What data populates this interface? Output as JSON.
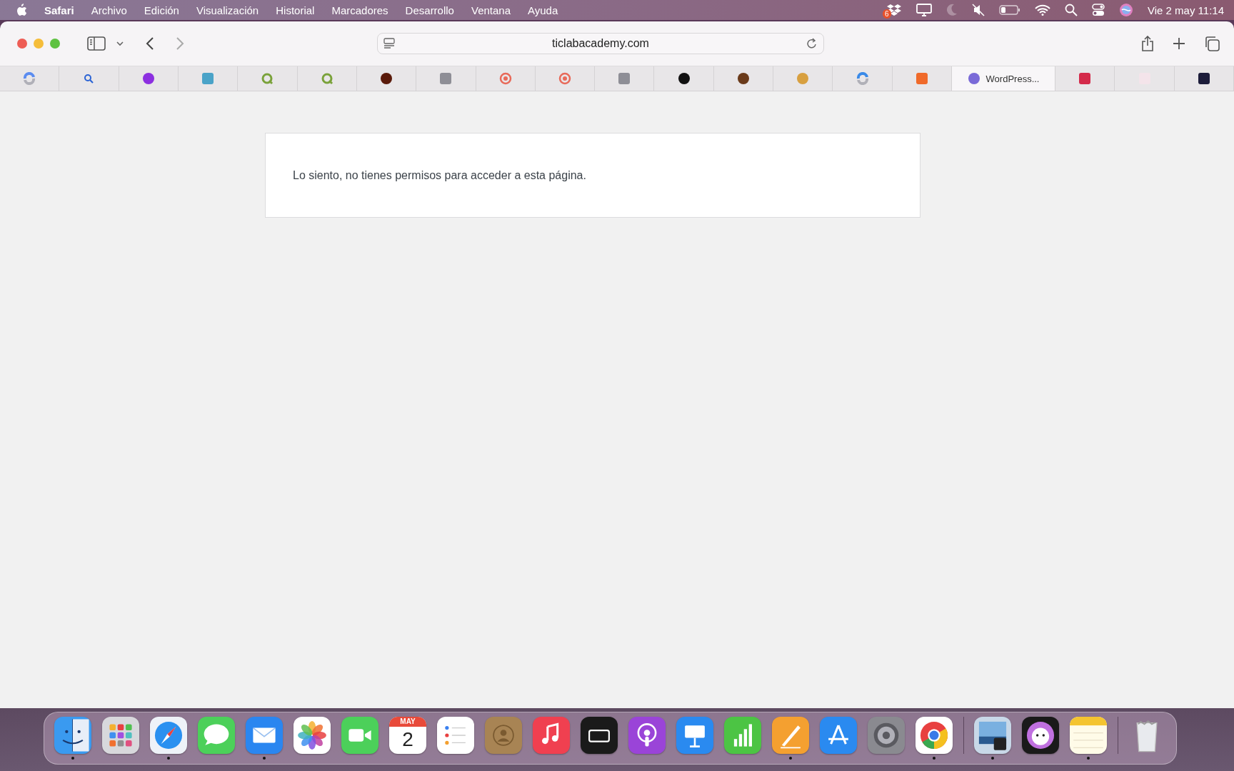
{
  "menu_bar": {
    "app_name": "Safari",
    "menus": [
      "Archivo",
      "Edición",
      "Visualización",
      "Historial",
      "Marcadores",
      "Desarrollo",
      "Ventana",
      "Ayuda"
    ],
    "dropbox_badge": "6",
    "clock": "Vie 2 may 11:14"
  },
  "toolbar": {
    "address": "ticlabacademy.com"
  },
  "tabs": [
    {
      "kind": "swirl",
      "color": "#5b8cf0",
      "selected": false
    },
    {
      "kind": "search",
      "color": "#2a63d4",
      "selected": false
    },
    {
      "kind": "circle",
      "color": "#8c2fe0",
      "selected": false
    },
    {
      "kind": "square",
      "color": "#4aa3c8",
      "selected": false
    },
    {
      "kind": "ring",
      "color": "#7aa23a",
      "selected": false
    },
    {
      "kind": "ring",
      "color": "#7aa23a",
      "selected": false
    },
    {
      "kind": "circle",
      "color": "#5a1a0a",
      "selected": false
    },
    {
      "kind": "square",
      "color": "#8e8e96",
      "selected": false
    },
    {
      "kind": "target",
      "color": "#e86a5a",
      "selected": false
    },
    {
      "kind": "target",
      "color": "#e86a5a",
      "selected": false
    },
    {
      "kind": "square",
      "color": "#8e8e96",
      "selected": false
    },
    {
      "kind": "circle",
      "color": "#111111",
      "selected": false
    },
    {
      "kind": "circle",
      "color": "#6a3a1a",
      "selected": false
    },
    {
      "kind": "circle",
      "color": "#d8a040",
      "selected": false
    },
    {
      "kind": "swirl",
      "color": "#3a8ae8",
      "selected": false
    },
    {
      "kind": "square",
      "color": "#f06a2a",
      "selected": false
    },
    {
      "kind": "circle",
      "color": "#7a6ad8",
      "selected": true,
      "title": "WordPress..."
    },
    {
      "kind": "square",
      "color": "#d42a4a",
      "selected": false
    },
    {
      "kind": "square",
      "color": "#f4e4ea",
      "selected": false
    },
    {
      "kind": "square",
      "color": "#1c1c3a",
      "selected": false
    }
  ],
  "page": {
    "message": "Lo siento, no tienes permisos para acceder a esta página."
  },
  "dock": {
    "groups": [
      [
        {
          "kind": "finder",
          "color": "#3a9af0",
          "running": true
        },
        {
          "kind": "grid",
          "color": "#d8d8dc",
          "running": false
        },
        {
          "kind": "compass",
          "color": "#eef2f8",
          "running": true
        },
        {
          "kind": "bubble",
          "color": "#4cd05a",
          "running": false
        },
        {
          "kind": "envelope",
          "color": "#2a86f0",
          "running": true
        },
        {
          "kind": "flower",
          "color": "#ffffff",
          "running": false
        },
        {
          "kind": "camera",
          "color": "#4cd05a",
          "running": false
        },
        {
          "kind": "calendar",
          "color": "#ffffff",
          "running": false,
          "month": "MAY",
          "day": "2"
        },
        {
          "kind": "list",
          "color": "#ffffff",
          "running": false
        },
        {
          "kind": "person",
          "color": "#a88454",
          "running": false
        },
        {
          "kind": "note",
          "color": "#f04050",
          "running": false
        },
        {
          "kind": "tv",
          "color": "#1a1a1a",
          "running": false
        },
        {
          "kind": "podcast",
          "color": "#9a44d8",
          "running": false
        },
        {
          "kind": "lectern",
          "color": "#2a8af0",
          "running": false
        },
        {
          "kind": "bars",
          "color": "#4cc444",
          "running": false
        },
        {
          "kind": "pen",
          "color": "#f4a030",
          "running": true
        },
        {
          "kind": "store",
          "color": "#2a8af0",
          "running": false
        },
        {
          "kind": "gear",
          "color": "#8a8a90",
          "running": false
        },
        {
          "kind": "chrome",
          "color": "#ffffff",
          "running": true
        }
      ],
      [
        {
          "kind": "preview",
          "color": "#c8d8e8",
          "running": true
        },
        {
          "kind": "pet",
          "color": "#1a1a1a",
          "running": false
        },
        {
          "kind": "notepad",
          "color": "#fffbe8",
          "running": true
        }
      ],
      [
        {
          "kind": "trash",
          "color": "#e8eaee",
          "running": false
        }
      ]
    ]
  }
}
